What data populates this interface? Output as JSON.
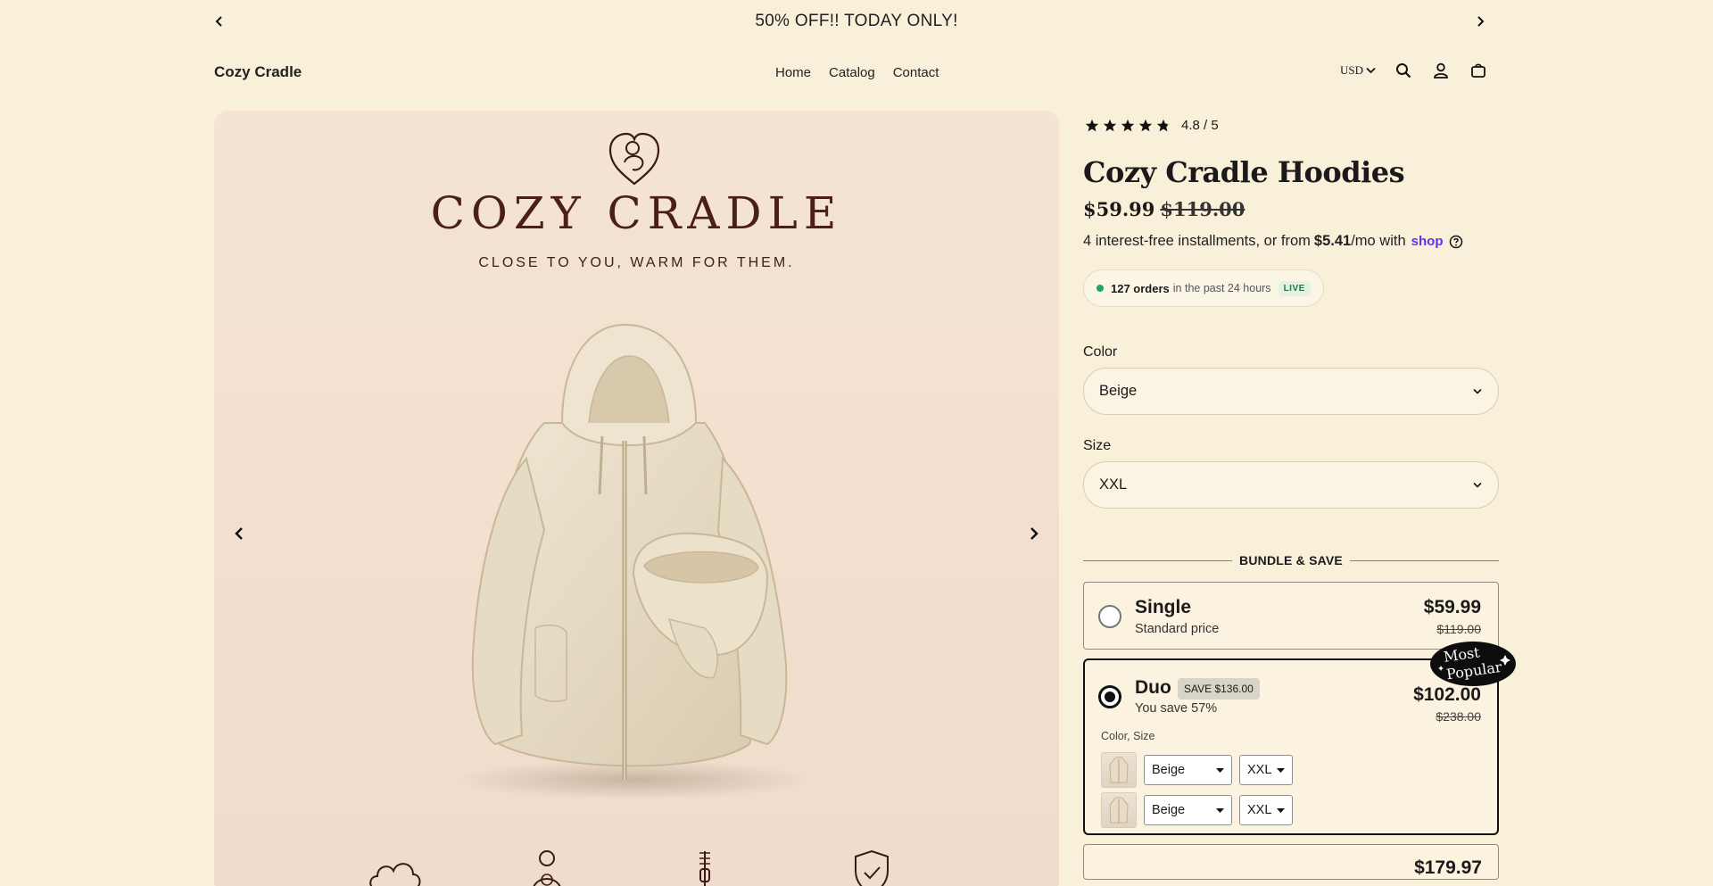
{
  "announcement": {
    "text": "50% OFF!! TODAY ONLY!"
  },
  "header": {
    "brand": "Cozy Cradle",
    "nav": [
      "Home",
      "Catalog",
      "Contact"
    ],
    "currency": "USD"
  },
  "gallery": {
    "brand_title": "COZY CRADLE",
    "tagline": "CLOSE TO YOU, WARM FOR THEM."
  },
  "product": {
    "rating_text": "4.8 / 5",
    "rating_value": 4.8,
    "title": "Cozy Cradle Hoodies",
    "price": "$59.99",
    "compare_price": "$119.00",
    "installments_prefix": "4 interest-free installments, or from",
    "installments_amount": "$5.41",
    "installments_suffix": "/mo with",
    "installments_provider": "shop",
    "orders_count": "127 orders",
    "orders_period": "in the past 24 hours",
    "live_badge": "LIVE",
    "color_label": "Color",
    "color_value": "Beige",
    "size_label": "Size",
    "size_value": "XXL"
  },
  "bundle": {
    "heading": "BUNDLE & SAVE",
    "options": [
      {
        "title": "Single",
        "subtitle": "Standard price",
        "price": "$59.99",
        "compare_price": "$119.00"
      },
      {
        "title": "Duo",
        "badge": "SAVE $136.00",
        "subtitle": "You save 57%",
        "price": "$102.00",
        "compare_price": "$238.00",
        "variant_label": "Color, Size",
        "variants": [
          {
            "color": "Beige",
            "size": "XXL"
          },
          {
            "color": "Beige",
            "size": "XXL"
          }
        ],
        "ribbon_line1": "Most",
        "ribbon_line2": "Popular"
      },
      {
        "price": "$179.97"
      }
    ]
  }
}
